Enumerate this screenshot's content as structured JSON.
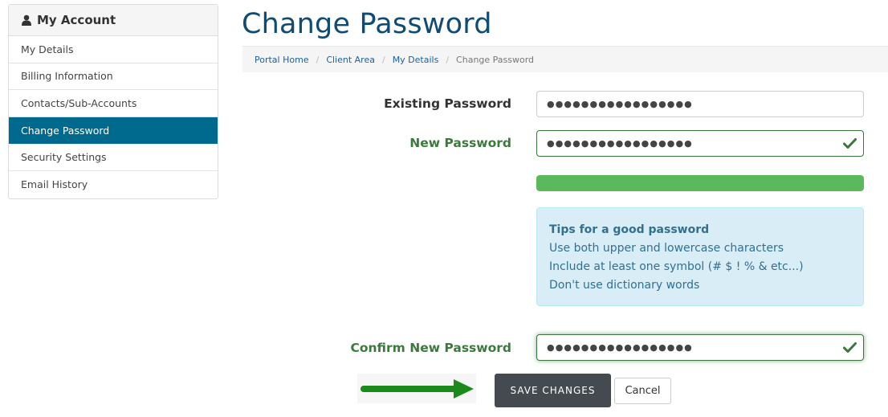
{
  "sidebar": {
    "title": "My Account",
    "items": [
      {
        "label": "My Details"
      },
      {
        "label": "Billing Information"
      },
      {
        "label": "Contacts/Sub-Accounts"
      },
      {
        "label": "Change Password",
        "active": true
      },
      {
        "label": "Security Settings"
      },
      {
        "label": "Email History"
      }
    ]
  },
  "page": {
    "title": "Change Password"
  },
  "breadcrumb": {
    "items": [
      "Portal Home",
      "Client Area",
      "My Details"
    ],
    "current": "Change Password"
  },
  "form": {
    "existing_label": "Existing Password",
    "existing_value": "●●●●●●●●●●●●●●●●●",
    "new_label": "New Password",
    "new_value": "●●●●●●●●●●●●●●●●●",
    "confirm_label": "Confirm New Password",
    "confirm_value": "●●●●●●●●●●●●●●●●●",
    "strength_percent": 100
  },
  "tips": {
    "title": "Tips for a good password",
    "lines": [
      "Use both upper and lowercase characters",
      "Include at least one symbol (# $ ! % & etc...)",
      "Don't use dictionary words"
    ]
  },
  "buttons": {
    "save": "SAVE CHANGES",
    "cancel": "Cancel"
  },
  "colors": {
    "accent": "#006a8e",
    "title": "#0f4c75",
    "success": "#3a7b3b",
    "strength": "#5cb85c",
    "tips_bg": "#d9edf7",
    "save_bg": "#444a4f",
    "arrow": "#1a8a1a"
  },
  "icons": {
    "sidebar_head": "user-icon",
    "field_valid": "check-icon",
    "annotation": "arrow-right-icon"
  }
}
